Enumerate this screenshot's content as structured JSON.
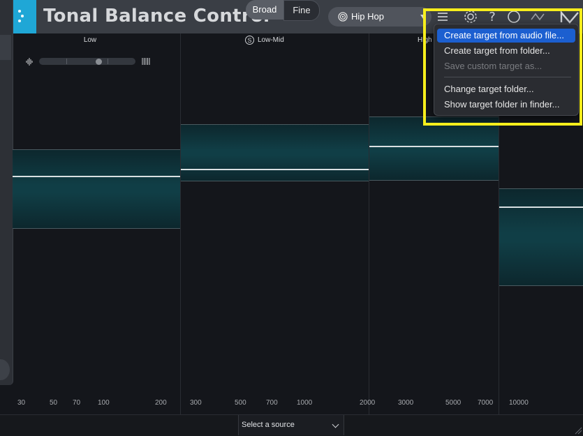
{
  "app": {
    "title": "Tonal Balance Control",
    "colors": {
      "accent": "#1fa7d6",
      "menu_highlight": "#1c5fd0",
      "annotation_box": "#f6ee1c"
    }
  },
  "header": {
    "view_toggle": {
      "broad": "Broad",
      "fine": "Fine",
      "selected": "Broad"
    },
    "preset": {
      "label": "Hip Hop",
      "icon": "target-icon"
    },
    "icons": [
      "menu-icon",
      "gear-icon",
      "help-icon",
      "refresh-icon",
      "route-icon",
      "n-logo-icon"
    ]
  },
  "bands": {
    "low": "Low",
    "low_mid": "Low-Mid",
    "low_mid_badge": "S",
    "high_mid": "High"
  },
  "axis_ticks": [
    "30",
    "50",
    "70",
    "100",
    "200",
    "300",
    "500",
    "700",
    "1000",
    "2000",
    "3000",
    "5000",
    "7000",
    "10000"
  ],
  "bottom": {
    "source_select": "Select a source"
  },
  "menu": {
    "items": [
      {
        "label": "Create target from audio file...",
        "state": "active"
      },
      {
        "label": "Create target from folder...",
        "state": "normal"
      },
      {
        "label": "Save custom target as...",
        "state": "disabled"
      },
      {
        "label": "Change target folder...",
        "state": "normal"
      },
      {
        "label": "Show target folder in finder...",
        "state": "normal"
      }
    ]
  }
}
